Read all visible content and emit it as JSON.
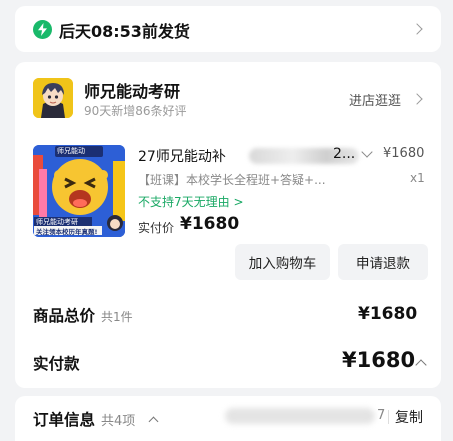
{
  "shipping": {
    "text": "后天08:53前发货",
    "icon": "lightning-icon",
    "icon_color": "#19b96a"
  },
  "shop": {
    "name": "师兄能动考研",
    "subtitle": "90天新增86条好评",
    "visit_label": "进店逛逛"
  },
  "product": {
    "title": "27师兄能动补",
    "title_tail": "2...",
    "price": "¥1680",
    "spec": "【班课】本校学长全程班+答疑+...",
    "qty": "x1",
    "policy": "不支持7天无理由 >",
    "paid_label": "实付价",
    "paid_value": "¥1680",
    "image_caption_top": "师兄能动",
    "image_caption_1": "师兄能动考研",
    "image_caption_2": "关注领本校历年真题!"
  },
  "actions": {
    "add_cart": "加入购物车",
    "refund": "申请退款"
  },
  "summary": {
    "total_label": "商品总价",
    "total_count": "共1件",
    "total_value": "¥1680",
    "paid_label": "实付款",
    "paid_value": "¥1680"
  },
  "order_info": {
    "label": "订单信息",
    "count": "共4项",
    "partial": "7",
    "copy": "复制"
  },
  "colors": {
    "accent_green": "#19a864",
    "page_bg": "#f2f3f5"
  }
}
